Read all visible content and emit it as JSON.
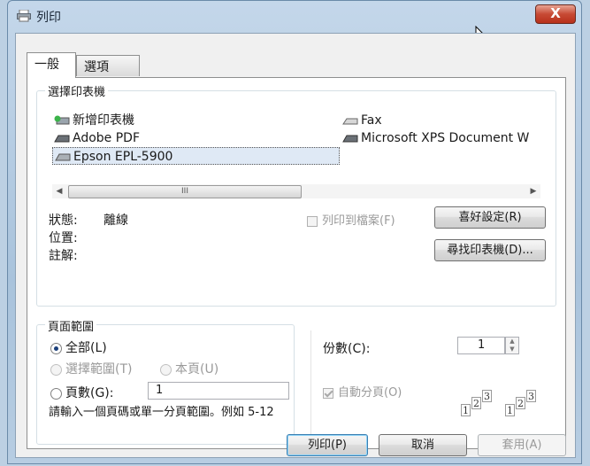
{
  "window": {
    "title": "列印",
    "close_label": "X"
  },
  "tabs": [
    {
      "label": "一般",
      "active": true
    },
    {
      "label": "選項",
      "active": false
    }
  ],
  "select_printer": {
    "legend": "選擇印表機",
    "printers": [
      {
        "name": "新增印表機",
        "icon": "add-printer-icon"
      },
      {
        "name": "Fax",
        "icon": "fax-icon"
      },
      {
        "name": "Adobe PDF",
        "icon": "printer-icon"
      },
      {
        "name": "Microsoft XPS Document W",
        "icon": "printer-icon"
      },
      {
        "name": "Epson EPL-5900",
        "icon": "printer-icon",
        "selected": true
      }
    ],
    "scroll_thumb_glyph": "III",
    "status_label": "狀態:",
    "status_value": "離線",
    "location_label": "位置:",
    "comment_label": "註解:",
    "print_to_file_label": "列印到檔案(F)",
    "preferences_button": "喜好設定(R)",
    "find_printer_button": "尋找印表機(D)..."
  },
  "page_range": {
    "legend": "頁面範圍",
    "all_label": "全部(L)",
    "selection_label": "選擇範圍(T)",
    "current_page_label": "本頁(U)",
    "pages_label": "頁數(G):",
    "pages_value": "1",
    "hint": "請輸入一個頁碼或單一分頁範圍。例如 5-12"
  },
  "copies": {
    "copies_label": "份數(C):",
    "copies_value": "1",
    "collate_label": "自動分頁(O)",
    "collate_checked": true
  },
  "footer": {
    "print_button": "列印(P)",
    "cancel_button": "取消",
    "apply_button": "套用(A)"
  },
  "colors": {
    "accent": "#3c7fb1",
    "close_red": "#c74a34",
    "disabled_text": "#9a9a9a"
  }
}
